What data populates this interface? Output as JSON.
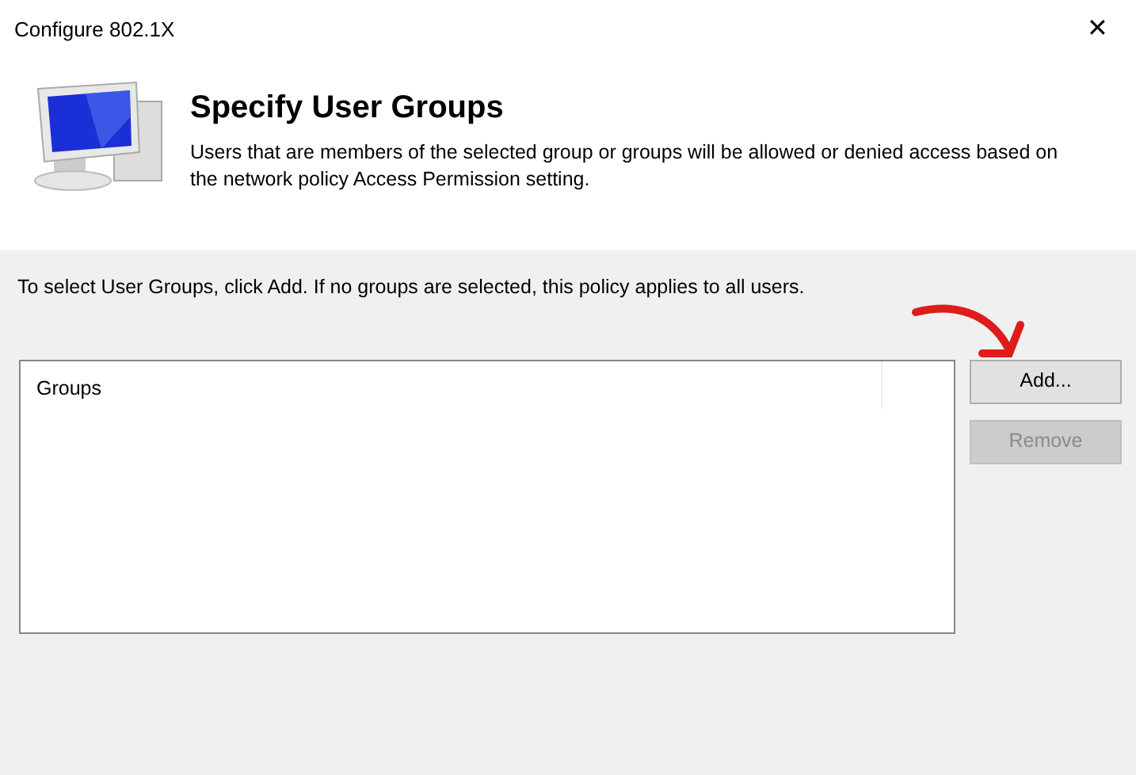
{
  "window": {
    "title": "Configure 802.1X",
    "close": "✕"
  },
  "header": {
    "title": "Specify User Groups",
    "description": "Users that are members of the selected group or groups will be allowed or denied access based on the network policy Access Permission setting."
  },
  "instruction": "To select User Groups, click Add. If no groups are selected, this policy applies to all users.",
  "list": {
    "columns": [
      "Groups"
    ]
  },
  "buttons": [
    {
      "label": "Add...",
      "disabled": false
    },
    {
      "label": "Remove",
      "disabled": true
    }
  ]
}
